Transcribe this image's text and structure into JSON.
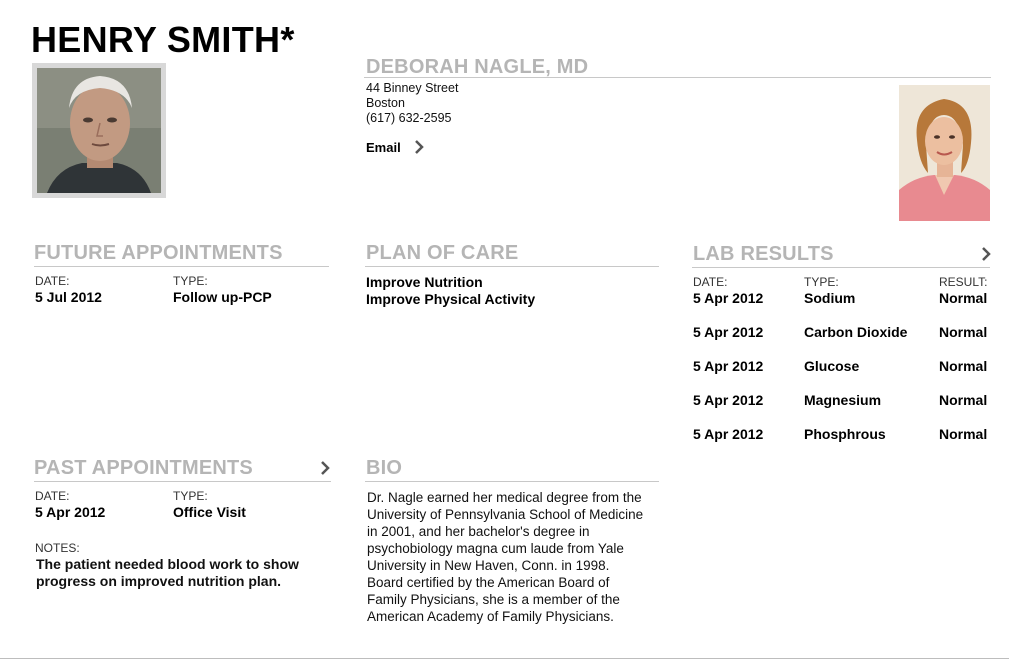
{
  "patient": {
    "name": "HENRY SMITH*"
  },
  "doctor": {
    "name": "DEBORAH NAGLE, MD",
    "address_line1": "44 Binney Street",
    "address_line2": "Boston",
    "phone": "(617) 632-2595",
    "email_label": "Email"
  },
  "future_appointments": {
    "title": "FUTURE APPOINTMENTS",
    "date_label": "DATE:",
    "type_label": "TYPE:",
    "items": [
      {
        "date": "5 Jul 2012",
        "type": "Follow up-PCP"
      }
    ]
  },
  "plan_of_care": {
    "title": "PLAN OF CARE",
    "items": [
      "Improve Nutrition",
      "Improve Physical Activity"
    ]
  },
  "lab_results": {
    "title": "LAB RESULTS",
    "date_label": "DATE:",
    "type_label": "TYPE:",
    "result_label": "RESULT:",
    "rows": [
      {
        "date": "5 Apr 2012",
        "type": "Sodium",
        "result": "Normal"
      },
      {
        "date": "5 Apr 2012",
        "type": "Carbon Dioxide",
        "result": "Normal"
      },
      {
        "date": "5 Apr 2012",
        "type": "Glucose",
        "result": "Normal"
      },
      {
        "date": "5 Apr 2012",
        "type": "Magnesium",
        "result": "Normal"
      },
      {
        "date": "5 Apr 2012",
        "type": "Phosphrous",
        "result": "Normal"
      }
    ]
  },
  "past_appointments": {
    "title": "PAST APPOINTMENTS",
    "date_label": "DATE:",
    "type_label": "TYPE:",
    "items": [
      {
        "date": "5 Apr 2012",
        "type": "Office Visit"
      }
    ],
    "notes_label": "NOTES:",
    "notes_line1": "The patient needed blood work to show",
    "notes_line2": "progress on improved nutrition plan."
  },
  "bio": {
    "title": "BIO",
    "lines": [
      "Dr. Nagle earned her medical degree from the",
      "University of Pennsylvania School of Medicine",
      "in 2001, and her bachelor's degree in",
      "psychobiology magna cum laude from Yale",
      "University in New Haven, Conn. in 1998.",
      "Board certified by the American Board of",
      "Family Physicians, she is a member of the",
      "American Academy of Family Physicians."
    ]
  },
  "colors": {
    "section_title": "#b5b5b5",
    "rule": "#c8c8c8",
    "chevron": "#555555"
  }
}
